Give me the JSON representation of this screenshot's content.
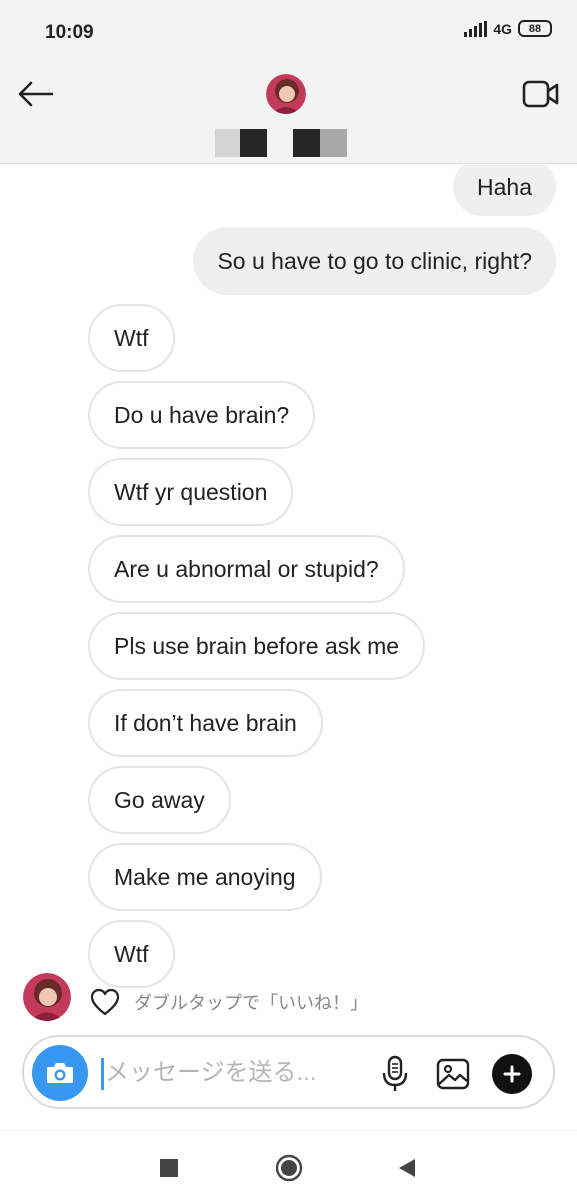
{
  "status_bar": {
    "time": "10:09",
    "network": "4G",
    "battery": "88"
  },
  "header": {
    "contact_name_redacted": true,
    "icons": [
      "back-arrow-icon",
      "avatar",
      "video-call-icon"
    ]
  },
  "messages": [
    {
      "direction": "out",
      "text": "Haha"
    },
    {
      "direction": "out",
      "text": "So u have to go to clinic, right?"
    },
    {
      "direction": "in",
      "text": "Wtf"
    },
    {
      "direction": "in",
      "text": "Do u have brain?"
    },
    {
      "direction": "in",
      "text": "Wtf yr question"
    },
    {
      "direction": "in",
      "text": "Are u abnormal or stupid?"
    },
    {
      "direction": "in",
      "text": "Pls use brain before ask me"
    },
    {
      "direction": "in",
      "text": "If don’t have brain"
    },
    {
      "direction": "in",
      "text": "Go away"
    },
    {
      "direction": "in",
      "text": "Make me anoying"
    },
    {
      "direction": "in",
      "text": "Wtf"
    }
  ],
  "like_hint": "ダブルタップで「いいね！」",
  "composer": {
    "placeholder": "メッセージを送る...",
    "value": ""
  },
  "colors": {
    "accent": "#3897f0",
    "outgoing_bubble": "#efefef",
    "incoming_border": "#e4e4e4",
    "header_bg": "#f3f3f3"
  }
}
